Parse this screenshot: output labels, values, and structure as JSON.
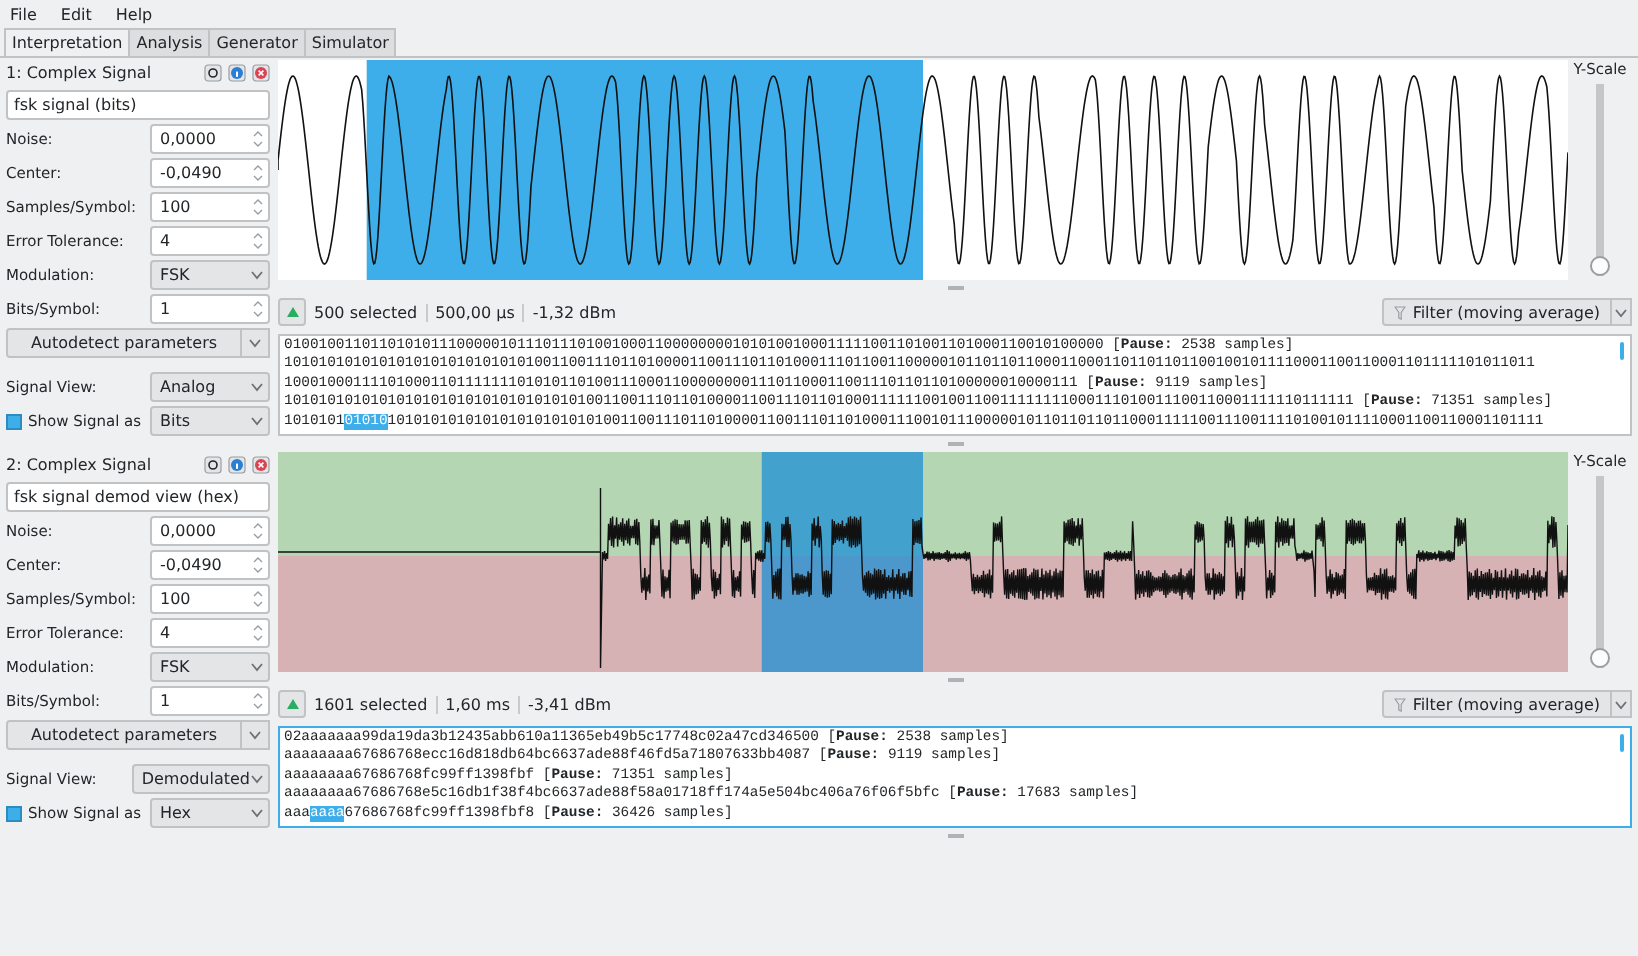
{
  "menu": [
    "File",
    "Edit",
    "Help"
  ],
  "tabs": [
    {
      "label": "Interpretation",
      "selected": true
    },
    {
      "label": "Analysis",
      "selected": false
    },
    {
      "label": "Generator",
      "selected": false
    },
    {
      "label": "Simulator",
      "selected": false
    }
  ],
  "signals": [
    {
      "title": "1: Complex Signal",
      "name": "fsk signal (bits)",
      "kind": "analog",
      "fields": [
        {
          "label": "Noise:",
          "value": "0,0000",
          "kind": "spin"
        },
        {
          "label": "Center:",
          "value": "-0,0490",
          "kind": "spin"
        },
        {
          "label": "Samples/Symbol:",
          "value": "100",
          "kind": "spin"
        },
        {
          "label": "Error Tolerance:",
          "value": "4",
          "kind": "spin"
        },
        {
          "label": "Modulation:",
          "value": "FSK",
          "kind": "combo"
        },
        {
          "label": "Bits/Symbol:",
          "value": "1",
          "kind": "spin"
        }
      ],
      "autodetect": "Autodetect parameters",
      "signal_view_label": "Signal View:",
      "signal_view": "Analog",
      "show_as_label": "Show Signal as",
      "show_as_checked": true,
      "show_as": "Bits",
      "y_scale": {
        "label": "Y-Scale",
        "level": 0
      },
      "selected": "500 selected",
      "duration": "500,00 µs",
      "power": "-1,32 dBm",
      "filter": "Filter (moving average)",
      "text_focused": false,
      "lines": [
        [
          {
            "text": "01001001101101010111000001011101110100100011000000001010100100011111001101001101000110010100000 [**Pause:** 2538 samples]",
            "selected": false
          }
        ],
        [
          {
            "text": "1010101010101010101010101010100110011101101000011001110110100011101100110000010110110110001100011011011011001001011110001100110001101111101011011",
            "selected": false
          }
        ],
        [
          {
            "text": "10001000111101000110111111101010110100111000110000000011101100011001110110110100000010000111 [**Pause:** 9119 samples]",
            "selected": false
          }
        ],
        [
          {
            "text": "1010101010101010101010101010101010100110011101101000011001110110100011111100100110011111111000111010011100110001111110111111 [**Pause:** 71351 samples]",
            "selected": false
          }
        ],
        [
          {
            "text": "1010101",
            "selected": false
          },
          {
            "text": "01010",
            "selected": true
          },
          {
            "text": "10101010101010101010101010011001110110100001100111011010001110010111000001011011011011000111110011100111101001011110001100110001101111",
            "selected": false
          }
        ]
      ]
    },
    {
      "title": "2: Complex Signal",
      "name": "fsk signal demod view (hex)",
      "kind": "demodulated",
      "fields": [
        {
          "label": "Noise:",
          "value": "0,0000",
          "kind": "spin"
        },
        {
          "label": "Center:",
          "value": "-0,0490",
          "kind": "spin"
        },
        {
          "label": "Samples/Symbol:",
          "value": "100",
          "kind": "spin"
        },
        {
          "label": "Error Tolerance:",
          "value": "4",
          "kind": "spin"
        },
        {
          "label": "Modulation:",
          "value": "FSK",
          "kind": "combo"
        },
        {
          "label": "Bits/Symbol:",
          "value": "1",
          "kind": "spin"
        }
      ],
      "autodetect": "Autodetect parameters",
      "signal_view_label": "Signal View:",
      "signal_view": "Demodulated",
      "show_as_label": "Show Signal as",
      "show_as_checked": true,
      "show_as": "Hex",
      "y_scale": {
        "label": "Y-Scale",
        "level": 0
      },
      "selected": "1601 selected",
      "duration": "1,60 ms",
      "power": "-3,41 dBm",
      "filter": "Filter (moving average)",
      "text_focused": true,
      "lines": [
        [
          {
            "text": "02aaaaaaa99da19da3b12435abb610a11365eb49b5c17748c02a47cd346500 [**Pause:** 2538 samples]",
            "selected": false
          }
        ],
        [
          {
            "text": "aaaaaaaa67686768ecc16d818db64bc6637ade88f46fd5a71807633bb4087 [**Pause:** 9119 samples]",
            "selected": false
          }
        ],
        [
          {
            "text": "aaaaaaaa67686768fc99ff1398fbf [**Pause:** 71351 samples]",
            "selected": false
          }
        ],
        [
          {
            "text": "aaaaaaaa67686768e5c16db1f38f4bc6637ade88f58a01718ff174a5e504bc406a76f06f5bfc [**Pause:** 17683 samples]",
            "selected": false
          }
        ],
        [
          {
            "text": "aaa",
            "selected": false
          },
          {
            "text": "aaaa",
            "selected": true
          },
          {
            "text": "67686768fc99ff1398fbf8 [**Pause:** 36426 samples]",
            "selected": false
          }
        ]
      ]
    }
  ]
}
